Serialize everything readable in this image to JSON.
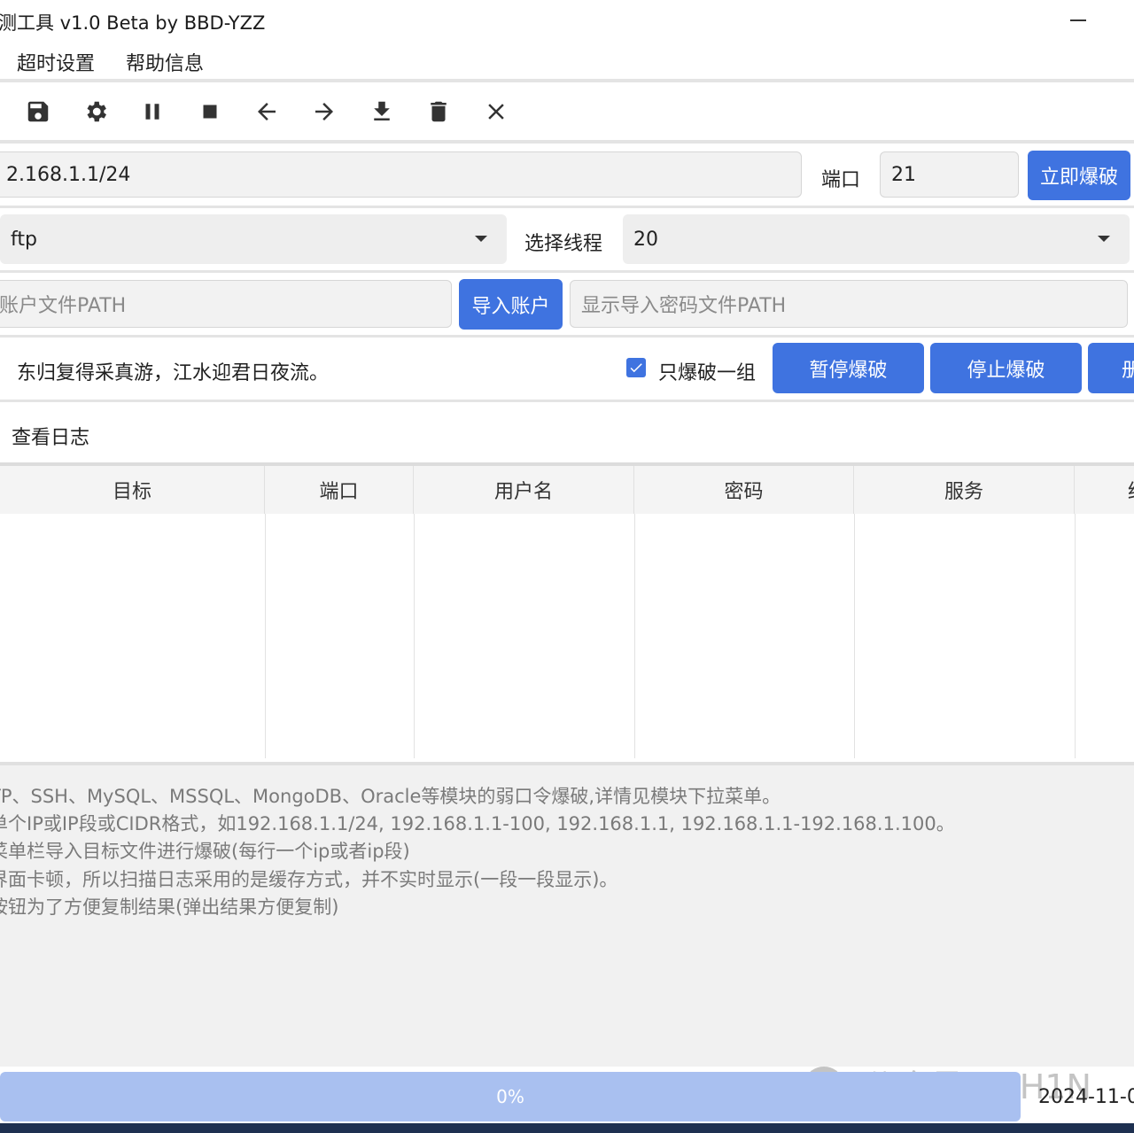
{
  "window": {
    "title": "测工具 v1.0 Beta by BBD-YZZ"
  },
  "menu": {
    "items": [
      "超时设置",
      "帮助信息"
    ]
  },
  "toolbar": {
    "icons": [
      "save-icon",
      "gear-icon",
      "pause-icon",
      "stop-icon",
      "arrow-left-icon",
      "arrow-right-icon",
      "download-icon",
      "trash-icon",
      "close-icon"
    ]
  },
  "target": {
    "value": "2.168.1.1/24",
    "port_label": "端口",
    "port_value": "21",
    "start_button": "立即爆破"
  },
  "options": {
    "service_selected": "ftp",
    "thread_label": "选择线程",
    "thread_selected": "20"
  },
  "files": {
    "user_path_placeholder": "账户文件PATH",
    "import_account_button": "导入账户",
    "password_path_placeholder": "显示导入密码文件PATH"
  },
  "controls": {
    "poem": "东归复得采真游，江水迎君日夜流。",
    "only_one_group_label": "只爆破一组",
    "only_one_group_checked": true,
    "pause_button": "暂停爆破",
    "stop_button": "停止爆破",
    "cut_button": "册"
  },
  "log": {
    "view_label": "查看日志"
  },
  "table": {
    "headers": [
      "目标",
      "端口",
      "用户名",
      "密码",
      "服务",
      "结"
    ],
    "rows": []
  },
  "help": {
    "lines": [
      "TP、SSH、MySQL、MSSQL、MongoDB、Oracle等模块的弱口令爆破,详情见模块下拉菜单。",
      "单个IP或IP段或CIDR格式，如192.168.1.1/24, 192.168.1.1-100, 192.168.1.1, 192.168.1.1-192.168.1.100。",
      "菜单栏导入目标文件进行爆破(每行一个ip或者ip段)",
      "界面卡顿，所以扫描日志采用的是缓存方式，并不实时显示(一段一段显示)。",
      "按钮为了方便复制结果(弹出结果方便复制)"
    ]
  },
  "status": {
    "progress_text": "0%",
    "progress_value": 0,
    "date": "2024-11-0"
  },
  "watermark": {
    "text": "公众号 · CH1N"
  },
  "colors": {
    "accent": "#3f73e0",
    "progress": "#a9c0f0"
  }
}
